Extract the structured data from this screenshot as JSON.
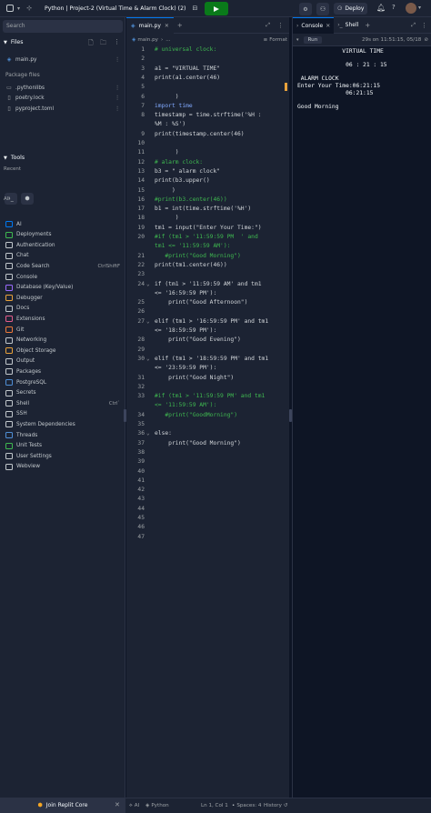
{
  "topbar": {
    "title": "Python | Project-2 (Virtual Time & Alarm Clock) (2)",
    "deploy_label": "Deploy"
  },
  "sidebar": {
    "search_placeholder": "Search",
    "files_title": "Files",
    "files": [
      {
        "name": "main.py",
        "icon": "python-file-icon"
      }
    ],
    "packager_title": "Package files",
    "package_files": [
      {
        "name": ".pythonlibs",
        "icon": "folder-icon"
      },
      {
        "name": "poetry.lock",
        "icon": "file-icon"
      },
      {
        "name": "pyproject.toml",
        "icon": "file-icon"
      }
    ],
    "tools_title": "Tools",
    "recent_label": "Recent",
    "all_label": "All",
    "tools": [
      {
        "name": "AI",
        "kbd": "",
        "color": "#0079f2"
      },
      {
        "name": "Deployments",
        "kbd": "",
        "color": "#3fb950"
      },
      {
        "name": "Authentication",
        "kbd": "",
        "color": "#c2c8cc"
      },
      {
        "name": "Chat",
        "kbd": "",
        "color": "#c2c8cc"
      },
      {
        "name": "Code Search",
        "kbd": "CtrlShiftF",
        "color": "#c2c8cc"
      },
      {
        "name": "Console",
        "kbd": "",
        "color": "#c2c8cc"
      },
      {
        "name": "Database (Key/Value)",
        "kbd": "",
        "color": "#9b6bff"
      },
      {
        "name": "Debugger",
        "kbd": "",
        "color": "#e9a23b"
      },
      {
        "name": "Docs",
        "kbd": "",
        "color": "#c2c8cc"
      },
      {
        "name": "Extensions",
        "kbd": "",
        "color": "#e65c8b"
      },
      {
        "name": "Git",
        "kbd": "",
        "color": "#f07a3a"
      },
      {
        "name": "Networking",
        "kbd": "",
        "color": "#c2c8cc"
      },
      {
        "name": "Object Storage",
        "kbd": "",
        "color": "#e9a23b"
      },
      {
        "name": "Output",
        "kbd": "",
        "color": "#c2c8cc"
      },
      {
        "name": "Packages",
        "kbd": "",
        "color": "#c2c8cc"
      },
      {
        "name": "PostgreSQL",
        "kbd": "",
        "color": "#4f8fd6"
      },
      {
        "name": "Secrets",
        "kbd": "",
        "color": "#c2c8cc"
      },
      {
        "name": "Shell",
        "kbd": "Ctrl`",
        "color": "#c2c8cc"
      },
      {
        "name": "SSH",
        "kbd": "",
        "color": "#c2c8cc"
      },
      {
        "name": "System Dependencies",
        "kbd": "",
        "color": "#c2c8cc"
      },
      {
        "name": "Threads",
        "kbd": "",
        "color": "#4f8fd6"
      },
      {
        "name": "Unit Tests",
        "kbd": "",
        "color": "#3fb950"
      },
      {
        "name": "User Settings",
        "kbd": "",
        "color": "#c2c8cc"
      },
      {
        "name": "Webview",
        "kbd": "",
        "color": "#c2c8cc"
      }
    ],
    "join_label": "Join Replit Core"
  },
  "editor": {
    "tab_label": "main.py",
    "breadcrumb_file": "main.py",
    "breadcrumb_more": "...",
    "format_label": "Format",
    "lines": [
      {
        "n": "1",
        "text": "# universal clock:",
        "cls": "c-com"
      },
      {
        "n": "2",
        "text": "",
        "cls": ""
      },
      {
        "n": "3",
        "text": "a1 = \"VIRTUAL TIME\"",
        "cls": ""
      },
      {
        "n": "4",
        "text": "print(a1.center(46)",
        "cls": ""
      },
      {
        "n": "5",
        "text": "",
        "cls": ""
      },
      {
        "n": "6",
        "text": "      )",
        "cls": ""
      },
      {
        "n": "7",
        "text": "import time",
        "cls": "c-kw"
      },
      {
        "n": "8",
        "text": "timestamp = time.strftime('%H :",
        "cls": ""
      },
      {
        "n": "",
        "text": "%M : %S')",
        "cls": ""
      },
      {
        "n": "9",
        "text": "print(timestamp.center(46)",
        "cls": ""
      },
      {
        "n": "10",
        "text": "",
        "cls": ""
      },
      {
        "n": "11",
        "text": "      )",
        "cls": ""
      },
      {
        "n": "12",
        "text": "# alarm clock:",
        "cls": "c-com"
      },
      {
        "n": "13",
        "text": "b3 = \" alarm clock\"",
        "cls": ""
      },
      {
        "n": "14",
        "text": "print(b3.upper()",
        "cls": ""
      },
      {
        "n": "15",
        "text": "     )",
        "cls": ""
      },
      {
        "n": "16",
        "text": "#print(b3.center(46))",
        "cls": "c-com"
      },
      {
        "n": "17",
        "text": "b1 = int(time.strftime('%H')",
        "cls": ""
      },
      {
        "n": "18",
        "text": "      )",
        "cls": ""
      },
      {
        "n": "19",
        "text": "tm1 = input(\"Enter Your Time:\")",
        "cls": ""
      },
      {
        "n": "20",
        "text": "#if (tm1 > '11:59:59 PM  ' and",
        "cls": "c-com"
      },
      {
        "n": "",
        "text": "tm1 <= '11:59:59 AM'):",
        "cls": "c-com"
      },
      {
        "n": "21",
        "text": "   #print(\"Good Morning\")",
        "cls": "c-com"
      },
      {
        "n": "22",
        "text": "print(tm1.center(46))",
        "cls": ""
      },
      {
        "n": "23",
        "text": "",
        "cls": ""
      },
      {
        "n": "24",
        "text": "if (tm1 > '11:59:59 AM' and tm1",
        "cls": "",
        "fold": true
      },
      {
        "n": "",
        "text": "<= '16:59:59 PM'):",
        "cls": ""
      },
      {
        "n": "25",
        "text": "    print(\"Good Afternoon\")",
        "cls": ""
      },
      {
        "n": "26",
        "text": "",
        "cls": ""
      },
      {
        "n": "27",
        "text": "elif (tm1 > '16:59:59 PM' and tm1",
        "cls": "",
        "fold": true
      },
      {
        "n": "",
        "text": "<= '18:59:59 PM'):",
        "cls": ""
      },
      {
        "n": "28",
        "text": "    print(\"Good Evening\")",
        "cls": ""
      },
      {
        "n": "29",
        "text": "",
        "cls": ""
      },
      {
        "n": "30",
        "text": "elif (tm1 > '18:59:59 PM' and tm1",
        "cls": "",
        "fold": true
      },
      {
        "n": "",
        "text": "<= '23:59:59 PM'):",
        "cls": ""
      },
      {
        "n": "31",
        "text": "    print(\"Good Night\")",
        "cls": ""
      },
      {
        "n": "32",
        "text": "",
        "cls": ""
      },
      {
        "n": "33",
        "text": "#if (tm1 > '11:59:59 PM' and tm1",
        "cls": "c-com"
      },
      {
        "n": "",
        "text": "<= '11:59:59 AM'):",
        "cls": "c-com"
      },
      {
        "n": "34",
        "text": "   #print(\"GoodMorning\")",
        "cls": "c-com"
      },
      {
        "n": "35",
        "text": "",
        "cls": ""
      },
      {
        "n": "36",
        "text": "else:",
        "cls": "",
        "fold": true
      },
      {
        "n": "37",
        "text": "    print(\"Good Morning\")",
        "cls": ""
      },
      {
        "n": "38",
        "text": "",
        "cls": ""
      },
      {
        "n": "39",
        "text": "",
        "cls": ""
      },
      {
        "n": "40",
        "text": "",
        "cls": ""
      },
      {
        "n": "41",
        "text": "",
        "cls": ""
      },
      {
        "n": "42",
        "text": "",
        "cls": ""
      },
      {
        "n": "43",
        "text": "",
        "cls": ""
      },
      {
        "n": "44",
        "text": "",
        "cls": ""
      },
      {
        "n": "45",
        "text": "",
        "cls": ""
      },
      {
        "n": "46",
        "text": "",
        "cls": ""
      },
      {
        "n": "47",
        "text": "",
        "cls": ""
      }
    ]
  },
  "console": {
    "tab_console": "Console",
    "tab_shell": "Shell",
    "run_label": "Run",
    "status": "29s on 11:51:15, 05/18",
    "output": [
      "             VIRTUAL TIME",
      "",
      "              06 : 21 : 15",
      "",
      " ALARM CLOCK",
      "Enter Your Time:06:21:15",
      "              06:21:15",
      "",
      "Good Morning"
    ]
  },
  "statusbar": {
    "ai_label": "AI",
    "lang_label": "Python",
    "position": "Ln 1, Col 1",
    "spaces": "Spaces: 4",
    "history": "History"
  }
}
